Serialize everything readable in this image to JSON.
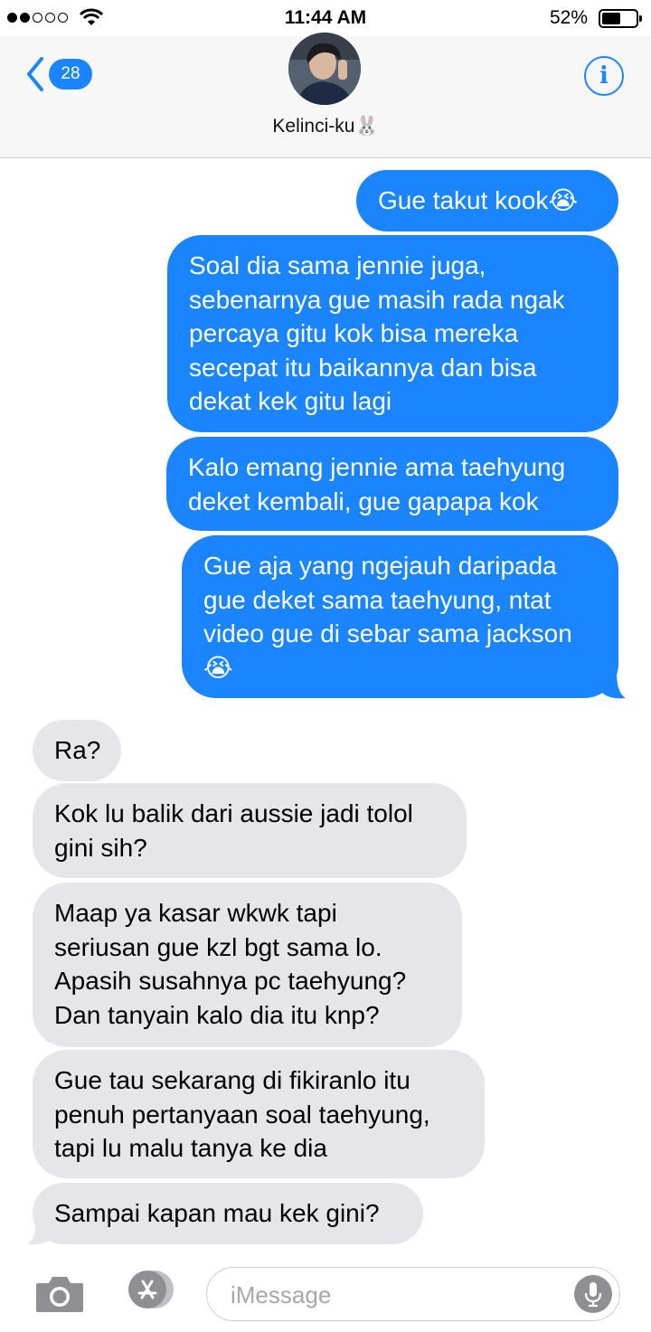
{
  "status_bar": {
    "time": "11:44 AM",
    "battery_percent": "52%",
    "battery_level": 0.52,
    "signal_bars_filled": 2,
    "signal_bars_total": 5,
    "wifi_icon": "wifi-icon"
  },
  "header": {
    "back_icon": "chevron-left-icon",
    "unread_count": "28",
    "contact_name": "Kelinci-ku🐰",
    "info_icon": "info-icon"
  },
  "messages": [
    {
      "direction": "sent",
      "text": "Gue takut kook😭"
    },
    {
      "direction": "sent",
      "text": "Soal dia sama jennie juga,\nsebenarnya gue masih rada ngak\npercaya gitu kok bisa mereka\nsecepat itu baikannya dan bisa\ndekat kek gitu lagi"
    },
    {
      "direction": "sent",
      "text": "Kalo emang jennie ama taehyung\ndeket kembali, gue gapapa kok"
    },
    {
      "direction": "sent",
      "text": "Gue aja yang ngejauh daripada\ngue deket sama taehyung, ntat\nvideo gue di sebar sama jackson\n😭"
    },
    {
      "direction": "received",
      "text": "Ra?"
    },
    {
      "direction": "received",
      "text": "Kok lu balik dari aussie jadi tolol\ngini sih?"
    },
    {
      "direction": "received",
      "text": "Maap ya kasar wkwk tapi\nseriusan gue kzl bgt sama lo.\nApasih susahnya pc taehyung?\nDan tanyain kalo dia itu knp?"
    },
    {
      "direction": "received",
      "text": "Gue tau sekarang di fikiranlo itu\npenuh pertanyaan soal taehyung,\ntapi lu malu tanya ke dia"
    },
    {
      "direction": "received",
      "text": "Sampai kapan mau kek gini?"
    }
  ],
  "input_bar": {
    "placeholder": "iMessage",
    "camera_icon": "camera-icon",
    "appstore_icon": "app-store-icon",
    "mic_icon": "microphone-icon"
  },
  "colors": {
    "sent_bubble": "#1a85ff",
    "received_bubble": "#e5e5ea",
    "accent": "#1a85ff"
  }
}
